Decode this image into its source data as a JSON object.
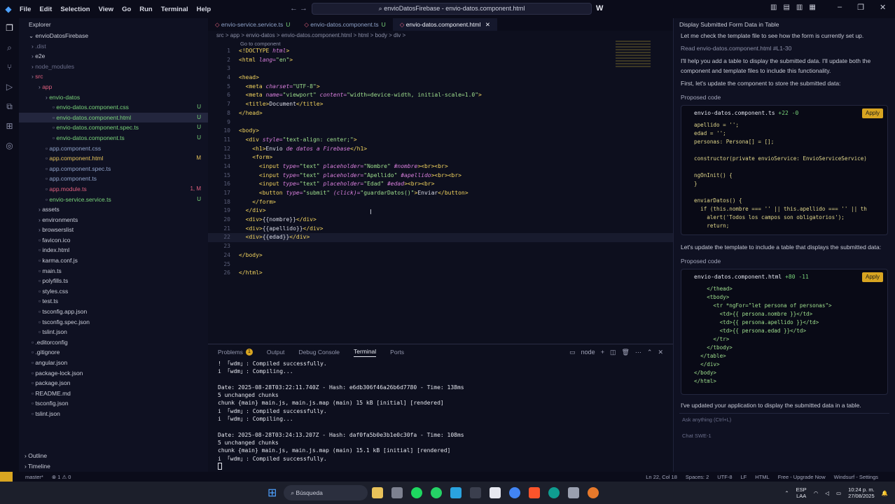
{
  "menu": [
    "File",
    "Edit",
    "Selection",
    "View",
    "Go",
    "Run",
    "Terminal",
    "Help"
  ],
  "command_center": "envioDatosFirebase - envio-datos.component.html",
  "explorer": {
    "title": "Explorer",
    "root": "envioDatosFirebase",
    "items": [
      {
        "label": ".dist",
        "indent": 1,
        "color": "#6a6e8a",
        "status": ""
      },
      {
        "label": "e2e",
        "indent": 1,
        "color": "#c9ccd8",
        "status": ""
      },
      {
        "label": "node_modules",
        "indent": 1,
        "color": "#6a6e8a",
        "status": ""
      },
      {
        "label": "src",
        "indent": 1,
        "color": "#e0607e",
        "status": ""
      },
      {
        "label": "app",
        "indent": 2,
        "color": "#e0607e",
        "status": ""
      },
      {
        "label": "envio-datos",
        "indent": 3,
        "color": "#79d47a",
        "status": ""
      },
      {
        "label": "envio-datos.component.css",
        "indent": 4,
        "color": "#79d47a",
        "status": "U"
      },
      {
        "label": "envio-datos.component.html",
        "indent": 4,
        "color": "#79d47a",
        "status": "U"
      },
      {
        "label": "envio-datos.component.spec.ts",
        "indent": 4,
        "color": "#79d47a",
        "status": "U"
      },
      {
        "label": "envio-datos.component.ts",
        "indent": 4,
        "color": "#79d47a",
        "status": "U"
      },
      {
        "label": "app.component.css",
        "indent": 3,
        "color": "#8fa2c8",
        "status": ""
      },
      {
        "label": "app.component.html",
        "indent": 3,
        "color": "#e6c35a",
        "status": "M"
      },
      {
        "label": "app.component.spec.ts",
        "indent": 3,
        "color": "#8fa2c8",
        "status": ""
      },
      {
        "label": "app.component.ts",
        "indent": 3,
        "color": "#8fa2c8",
        "status": ""
      },
      {
        "label": "app.module.ts",
        "indent": 3,
        "color": "#e0607e",
        "status": "1, M"
      },
      {
        "label": "envio-service.service.ts",
        "indent": 3,
        "color": "#79d47a",
        "status": "U"
      },
      {
        "label": "assets",
        "indent": 2,
        "color": "#c9ccd8",
        "status": ""
      },
      {
        "label": "environments",
        "indent": 2,
        "color": "#c9ccd8",
        "status": ""
      },
      {
        "label": "browserslist",
        "indent": 2,
        "color": "#c9ccd8",
        "status": ""
      },
      {
        "label": "favicon.ico",
        "indent": 2,
        "color": "#c9ccd8",
        "status": ""
      },
      {
        "label": "index.html",
        "indent": 2,
        "color": "#c9ccd8",
        "status": ""
      },
      {
        "label": "karma.conf.js",
        "indent": 2,
        "color": "#c9ccd8",
        "status": ""
      },
      {
        "label": "main.ts",
        "indent": 2,
        "color": "#c9ccd8",
        "status": ""
      },
      {
        "label": "polyfills.ts",
        "indent": 2,
        "color": "#c9ccd8",
        "status": ""
      },
      {
        "label": "styles.css",
        "indent": 2,
        "color": "#c9ccd8",
        "status": ""
      },
      {
        "label": "test.ts",
        "indent": 2,
        "color": "#c9ccd8",
        "status": ""
      },
      {
        "label": "tsconfig.app.json",
        "indent": 2,
        "color": "#c9ccd8",
        "status": ""
      },
      {
        "label": "tsconfig.spec.json",
        "indent": 2,
        "color": "#c9ccd8",
        "status": ""
      },
      {
        "label": "tslint.json",
        "indent": 2,
        "color": "#c9ccd8",
        "status": ""
      },
      {
        "label": ".editorconfig",
        "indent": 1,
        "color": "#c9ccd8",
        "status": ""
      },
      {
        "label": ".gitignore",
        "indent": 1,
        "color": "#c9ccd8",
        "status": ""
      },
      {
        "label": "angular.json",
        "indent": 1,
        "color": "#c9ccd8",
        "status": ""
      },
      {
        "label": "package-lock.json",
        "indent": 1,
        "color": "#c9ccd8",
        "status": ""
      },
      {
        "label": "package.json",
        "indent": 1,
        "color": "#c9ccd8",
        "status": ""
      },
      {
        "label": "README.md",
        "indent": 1,
        "color": "#c9ccd8",
        "status": ""
      },
      {
        "label": "tsconfig.json",
        "indent": 1,
        "color": "#c9ccd8",
        "status": ""
      },
      {
        "label": "tslint.json",
        "indent": 1,
        "color": "#c9ccd8",
        "status": ""
      }
    ],
    "outline": "Outline",
    "timeline": "Timeline"
  },
  "tabs": [
    {
      "label": "envio-service.service.ts",
      "status": "U",
      "active": false
    },
    {
      "label": "envio-datos.component.ts",
      "status": "U",
      "active": false
    },
    {
      "label": "envio-datos.component.html",
      "status": "",
      "active": true
    }
  ],
  "breadcrumb": "src > app > envio-datos > envio-datos.component.html > html > body > div > ",
  "goto_component": "Go to component",
  "code": [
    "<!DOCTYPE html>",
    "<html lang=\"en\">",
    "",
    "<head>",
    "  <meta charset=\"UTF-8\">",
    "  <meta name=\"viewport\" content=\"width=device-width, initial-scale=1.0\">",
    "  <title>Document</title>",
    "</head>",
    "",
    "<body>",
    "  <div style=\"text-align: center;\">",
    "    <h1>Envio de datos a Firebase</h1>",
    "    <form>",
    "      <input type=\"text\" placeholder=\"Nombre\" #nombre><br><br>",
    "      <input type=\"text\" placeholder=\"Apellido\" #apellido><br><br>",
    "      <input type=\"text\" placeholder=\"Edad\" #edad><br><br>",
    "      <button type=\"submit\" (click)=\"guardarDatos()\">Enviar</button>",
    "    </form>",
    "  </div>",
    "  <div>{{nombre}}</div>",
    "  <div>{{apellido}}</div>",
    "  <div>{{edad}}</div>",
    "",
    "</body>",
    "",
    "</html>"
  ],
  "panel": {
    "tabs": [
      "Problems",
      "Output",
      "Debug Console",
      "Terminal",
      "Ports"
    ],
    "problems_count": "1",
    "shell": "node",
    "lines": [
      "! 「wdm」: Compiled successfully.",
      "i 「wdm」: Compiling...",
      "",
      "Date: 2025-08-28T03:22:11.740Z - Hash: e6db306f46a26b6d7780 - Time: 138ms",
      "5 unchanged chunks",
      "chunk {main} main.js, main.js.map (main) 15 kB [initial] [rendered]",
      "i 「wdm」: Compiled successfully.",
      "i 「wdm」: Compiling...",
      "",
      "Date: 2025-08-28T03:24:13.207Z - Hash: daf0fa5b0e3b1e0c30fa - Time: 108ms",
      "5 unchanged chunks",
      "chunk {main} main.js, main.js.map (main) 15.1 kB [initial] [rendered]",
      "i 「wdm」: Compiled successfully."
    ]
  },
  "chat": {
    "title": "Display Submitted Form Data in Table",
    "intro": "Let me check the template file to see how the form is currently set up.",
    "read": "Read envio-datos.component.html #L1-30",
    "p1": "I'll help you add a table to display the submitted data. I'll update both the component and template files to include this functionality.",
    "p2": "First, let's update the component to store the submitted data:",
    "proposed": "Proposed code",
    "card1": {
      "file": "envio-datos.component.ts",
      "diff": "+22 -0",
      "apply": "Apply",
      "lines": [
        "apellido = '';",
        "edad = '';",
        "personas: Persona[] = [];",
        "",
        "constructor(private envioService: EnvioServiceService)",
        "",
        "ngOnInit() {",
        "}",
        "",
        "enviarDatos() {",
        "  if (this.nombre === '' || this.apellido === '' || th",
        "    alert('Todos los campos son obligatorios');",
        "    return;"
      ]
    },
    "p3": "Let's update the template to include a table that displays the submitted data:",
    "card2": {
      "file": "envio-datos.component.html",
      "diff": "+80 -11",
      "apply": "Apply",
      "lines": [
        "    </thead>",
        "    <tbody>",
        "      <tr *ngFor=\"let persona of personas\">",
        "        <td>{{ persona.nombre }}</td>",
        "        <td>{{ persona.apellido }}</td>",
        "        <td>{{ persona.edad }}</td>",
        "      </tr>",
        "    </tbody>",
        "  </table>",
        "  </div>",
        "</body>",
        "</html>"
      ]
    },
    "p4": "I've updated your application to display the submitted data in a table.",
    "input_placeholder": "Ask anything (Ctrl+L)",
    "mode": "Chat",
    "model": "SWE-1"
  },
  "status": {
    "branch": "master*",
    "errors": "⊗ 1 ⚠ 0",
    "right": [
      "Ln 22, Col 18",
      "Spaces: 2",
      "UTF-8",
      "LF",
      "HTML",
      "Free - Upgrade Now",
      "Windsurf - Settings"
    ]
  },
  "taskbar": {
    "search": "Búsqueda",
    "lang": "ESP",
    "lang2": "LAA",
    "time": "10:24 p. m.",
    "date": "27/08/2025"
  }
}
